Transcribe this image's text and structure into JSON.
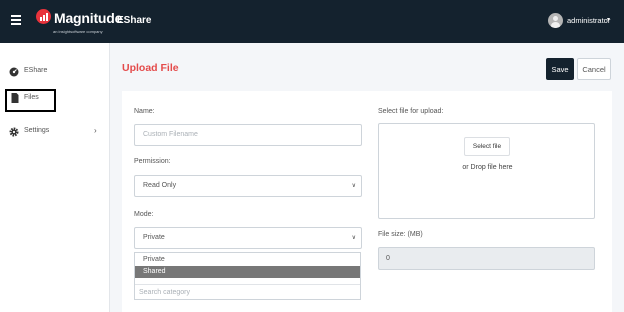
{
  "header": {
    "logo_text": "Magnitude",
    "logo_subtext": "an insightsoftware company",
    "app_title": "EShare",
    "username": "administrator",
    "user_caret": "▾"
  },
  "sidebar": {
    "items": [
      {
        "label": "EShare",
        "icon": "dashboard-icon"
      },
      {
        "label": "Files",
        "icon": "file-icon"
      },
      {
        "label": "Settings",
        "icon": "gear-icon",
        "chevron": "›"
      }
    ]
  },
  "page": {
    "title": "Upload File",
    "save_label": "Save",
    "cancel_label": "Cancel"
  },
  "form": {
    "name_label": "Name:",
    "name_placeholder": "Custom Filename",
    "permission_label": "Permission:",
    "permission_value": "Read Only",
    "mode_label": "Mode:",
    "mode_value": "Private",
    "mode_options": [
      "Private",
      "Shared"
    ],
    "mode_search_placeholder": "Search category",
    "upload_label": "Select file for upload:",
    "select_file_label": "Select file",
    "drop_text": "or Drop file here",
    "filesize_label": "File size: (MB)",
    "filesize_value": "0"
  },
  "colors": {
    "topbar": "#14222e",
    "accent_red": "#e44b4b",
    "selected_option": "#777777"
  }
}
